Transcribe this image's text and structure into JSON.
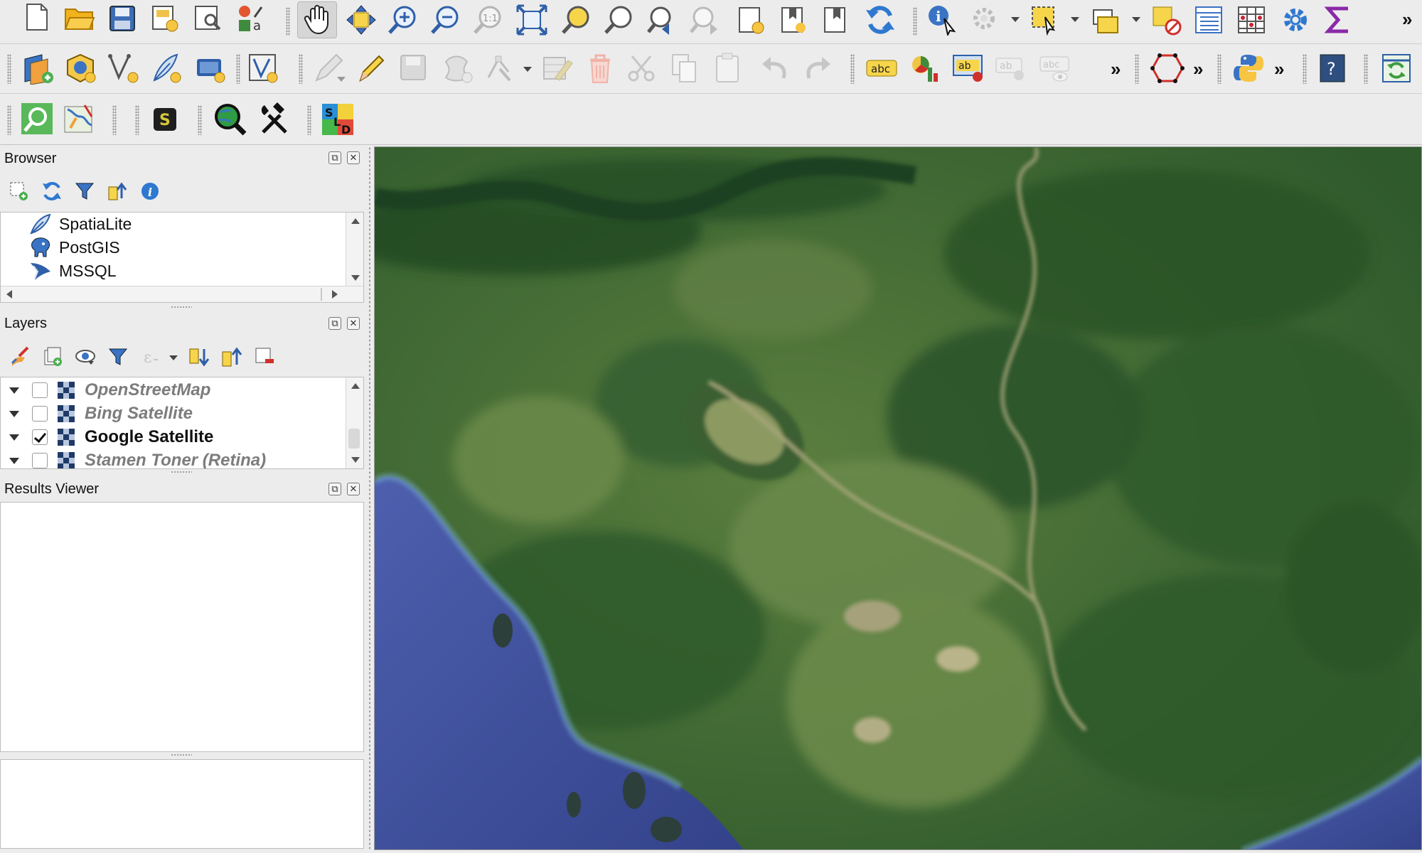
{
  "toolbar_row1": {
    "icons": [
      "new-project-icon",
      "open-project-icon",
      "save-project-icon",
      "new-print-layout-icon",
      "layout-manager-icon",
      "style-manager-icon",
      "pan-map-icon",
      "pan-to-selection-icon",
      "zoom-in-icon",
      "zoom-out-icon",
      "zoom-native-icon",
      "zoom-full-icon",
      "zoom-to-selection-icon",
      "zoom-to-layer-icon",
      "zoom-last-icon",
      "zoom-next-icon",
      "new-bookmark-icon",
      "show-bookmarks-icon",
      "new-map-view-icon",
      "refresh-icon",
      "identify-features-icon",
      "run-feature-action-icon",
      "select-features-icon",
      "open-attribute-table-icon",
      "deselect-all-icon",
      "statistical-summary-icon",
      "field-calculator-icon",
      "processing-toolbox-icon",
      "sum-icon"
    ],
    "overflow": "»"
  },
  "toolbar_row2": {
    "icons": [
      "data-source-manager-icon",
      "new-geopackage-layer-icon",
      "add-vector-layer-icon",
      "new-spatialite-layer-icon",
      "add-raster-layer-icon",
      "add-virtual-layer-icon",
      "current-edits-icon",
      "toggle-editing-icon",
      "save-edits-icon",
      "add-feature-icon",
      "vertex-tool-icon",
      "modify-attributes-icon",
      "delete-selected-icon",
      "cut-features-icon",
      "copy-features-icon",
      "paste-features-icon",
      "undo-icon",
      "redo-icon",
      "label-icon",
      "diagram-icon",
      "highlight-pinned-labels-icon",
      "pin-labels-icon",
      "show-hide-labels-icon",
      "digitize-shape-icon",
      "python-console-icon",
      "help-icon",
      "plugin-refresh-icon"
    ],
    "overflow": "»"
  },
  "toolbar_row3": {
    "icons": [
      "locator-search-icon",
      "georeferencer-icon",
      "semi-automatic-classification-icon",
      "globe-search-icon",
      "hammer-wrench-icon",
      "sld-style-icon"
    ],
    "sld_letters": [
      "S",
      "L",
      "D"
    ]
  },
  "browser": {
    "title": "Browser",
    "items": [
      {
        "label": "SpatiaLite",
        "icon": "spatialite-feather-icon"
      },
      {
        "label": "PostGIS",
        "icon": "postgis-elephant-icon"
      },
      {
        "label": "MSSQL",
        "icon": "mssql-icon"
      }
    ]
  },
  "layers": {
    "title": "Layers",
    "items": [
      {
        "label": "OpenStreetMap",
        "checked": false
      },
      {
        "label": "Bing Satellite",
        "checked": false
      },
      {
        "label": "Google Satellite",
        "checked": true
      },
      {
        "label": "Stamen Toner (Retina)",
        "checked": false
      }
    ]
  },
  "results_viewer": {
    "title": "Results Viewer"
  },
  "colors": {
    "toolbar_bg": "#ececec",
    "sea": "#3f4f9a",
    "land_dark": "#2f5a2c",
    "land_light": "#5d7c3f",
    "accent_blue": "#2a6fd6"
  }
}
